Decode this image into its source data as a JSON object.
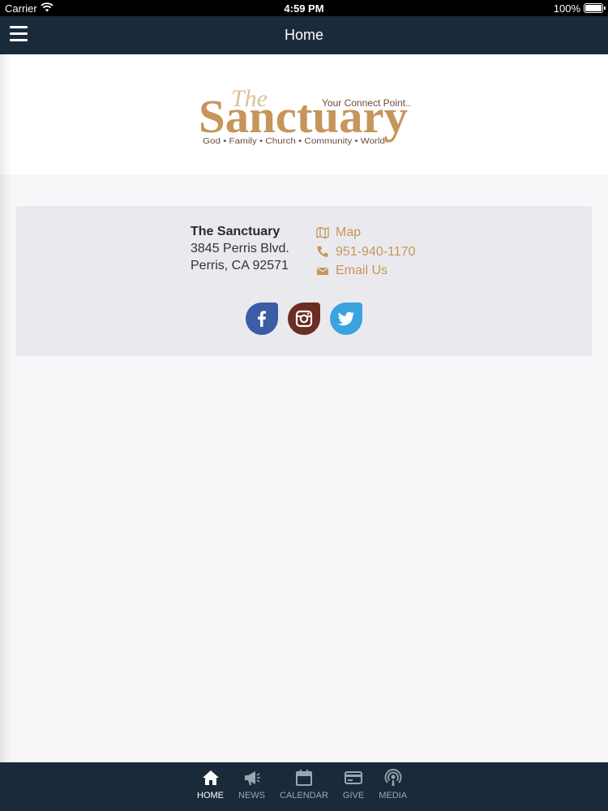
{
  "status_bar": {
    "carrier": "Carrier",
    "time": "4:59 PM",
    "battery": "100%"
  },
  "nav": {
    "title": "Home"
  },
  "logo": {
    "text_the": "The",
    "text_main": "Sanctuary",
    "tagline": "Your Connect Point..",
    "subline": "God • Family • Church • Community • World"
  },
  "address": {
    "name": "The Sanctuary",
    "street": "3845 Perris Blvd.",
    "city": "Perris, CA 92571"
  },
  "contacts": {
    "map_label": "Map",
    "phone": "951-940-1170",
    "email_label": "Email Us"
  },
  "socials": [
    "facebook-icon",
    "instagram-icon",
    "twitter-icon"
  ],
  "tabs": [
    {
      "label": "HOME",
      "icon": "home-icon"
    },
    {
      "label": "NEWS",
      "icon": "megaphone-icon"
    },
    {
      "label": "CALENDAR",
      "icon": "calendar-icon"
    },
    {
      "label": "GIVE",
      "icon": "credit-card-icon"
    },
    {
      "label": "MEDIA",
      "icon": "podcast-icon"
    }
  ],
  "colors": {
    "nav_bg": "#1b2a3b",
    "accent": "#c6955a",
    "card_bg": "#eaeaee"
  }
}
